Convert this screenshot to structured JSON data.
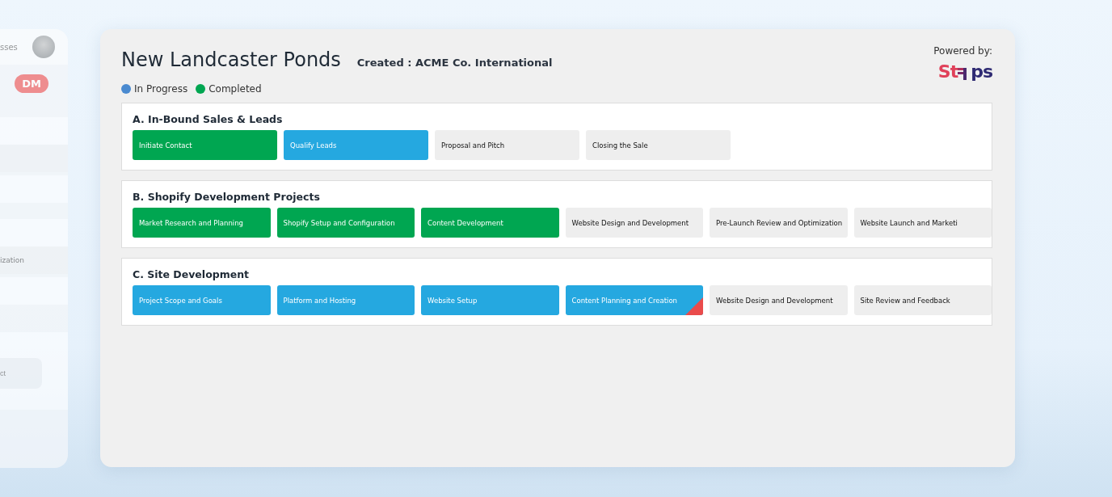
{
  "side_panel": {
    "header_text": "sses",
    "badge": "DM",
    "item_text": "ization",
    "field_placeholder": "ct"
  },
  "project": {
    "title": "New Landcaster Ponds",
    "created": "Created : ACME Co. International"
  },
  "powered_by": {
    "label": "Powered by:",
    "logo_left": "St",
    "logo_right": "ps"
  },
  "legend": [
    {
      "label": "In Progress",
      "color": "#4a8ad0"
    },
    {
      "label": "Completed",
      "color": "#00a651"
    }
  ],
  "sections": [
    {
      "title": "A. In-Bound Sales & Leads",
      "steps": [
        {
          "label": "Initiate Contact",
          "kind": "completed",
          "flagged": false
        },
        {
          "label": "Qualify Leads",
          "kind": "in_progress",
          "flagged": false
        },
        {
          "label": "Proposal and Pitch",
          "kind": "not_started",
          "flagged": false
        },
        {
          "label": "Closing the Sale",
          "kind": "not_started",
          "flagged": false
        }
      ]
    },
    {
      "title": "B. Shopify Development Projects",
      "steps": [
        {
          "label": "Market Research and Planning",
          "kind": "completed",
          "flagged": false
        },
        {
          "label": "Shopify Setup and Configuration",
          "kind": "completed",
          "flagged": false
        },
        {
          "label": "Content Development",
          "kind": "completed",
          "flagged": false
        },
        {
          "label": "Website Design and Development",
          "kind": "not_started",
          "flagged": false
        },
        {
          "label": "Pre-Launch Review and Optimization",
          "kind": "not_started",
          "flagged": false
        },
        {
          "label": "Website Launch and Marketi",
          "kind": "not_started",
          "flagged": false
        }
      ]
    },
    {
      "title": "C. Site Development",
      "steps": [
        {
          "label": "Project Scope and Goals",
          "kind": "in_progress",
          "flagged": false
        },
        {
          "label": "Platform and Hosting",
          "kind": "in_progress",
          "flagged": false
        },
        {
          "label": "Website Setup",
          "kind": "in_progress",
          "flagged": false
        },
        {
          "label": "Content Planning and Creation",
          "kind": "in_progress",
          "flagged": true
        },
        {
          "label": "Website Design and Development",
          "kind": "not_started",
          "flagged": false
        },
        {
          "label": "Site Review and Feedback",
          "kind": "not_started",
          "flagged": false
        }
      ]
    }
  ]
}
